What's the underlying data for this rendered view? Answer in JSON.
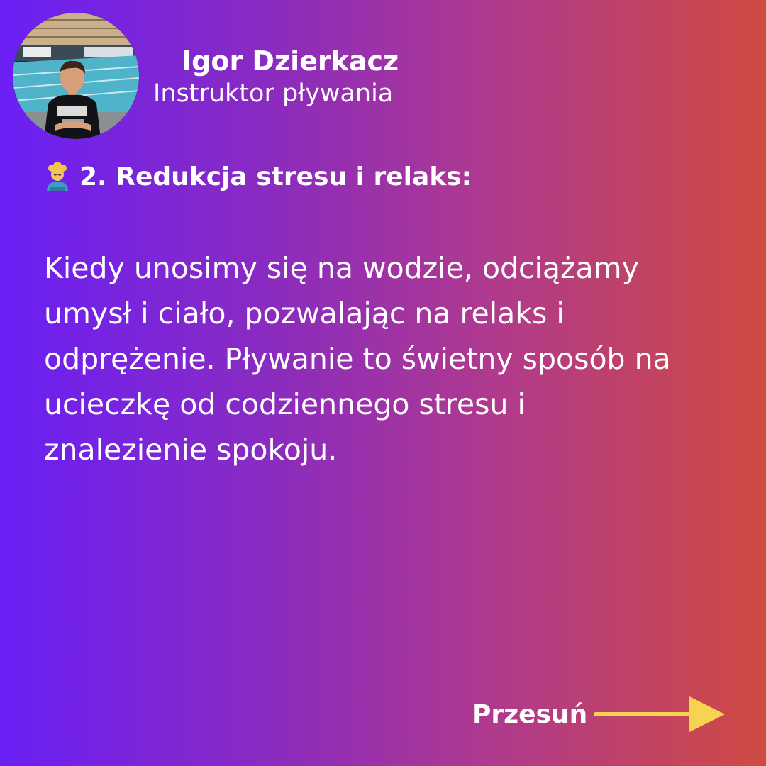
{
  "author": {
    "name": "Igor Dzierkacz",
    "role": "Instruktor pływania",
    "avatar": "avatar-photo-swimming-pool"
  },
  "heading": {
    "icon": "person-in-sauna-emoji",
    "text": "2. Redukcja stresu i relaks:"
  },
  "body": {
    "lines": [
      "Kiedy unosimy się na wodzie, odciążamy",
      "umysł i ciało, pozwalając na relaks i",
      "odprężenie. Pływanie to świetny sposób na",
      "ucieczkę od codziennego stresu i",
      "znalezienie spokoju."
    ]
  },
  "navigation": {
    "swipe_label": "Przesuń",
    "arrow_icon": "arrow-right-icon",
    "arrow_color": "#f6d452"
  },
  "colors": {
    "gradient_start": "#6a1ff5",
    "gradient_end": "#cf4a42",
    "text": "#ffffff"
  }
}
